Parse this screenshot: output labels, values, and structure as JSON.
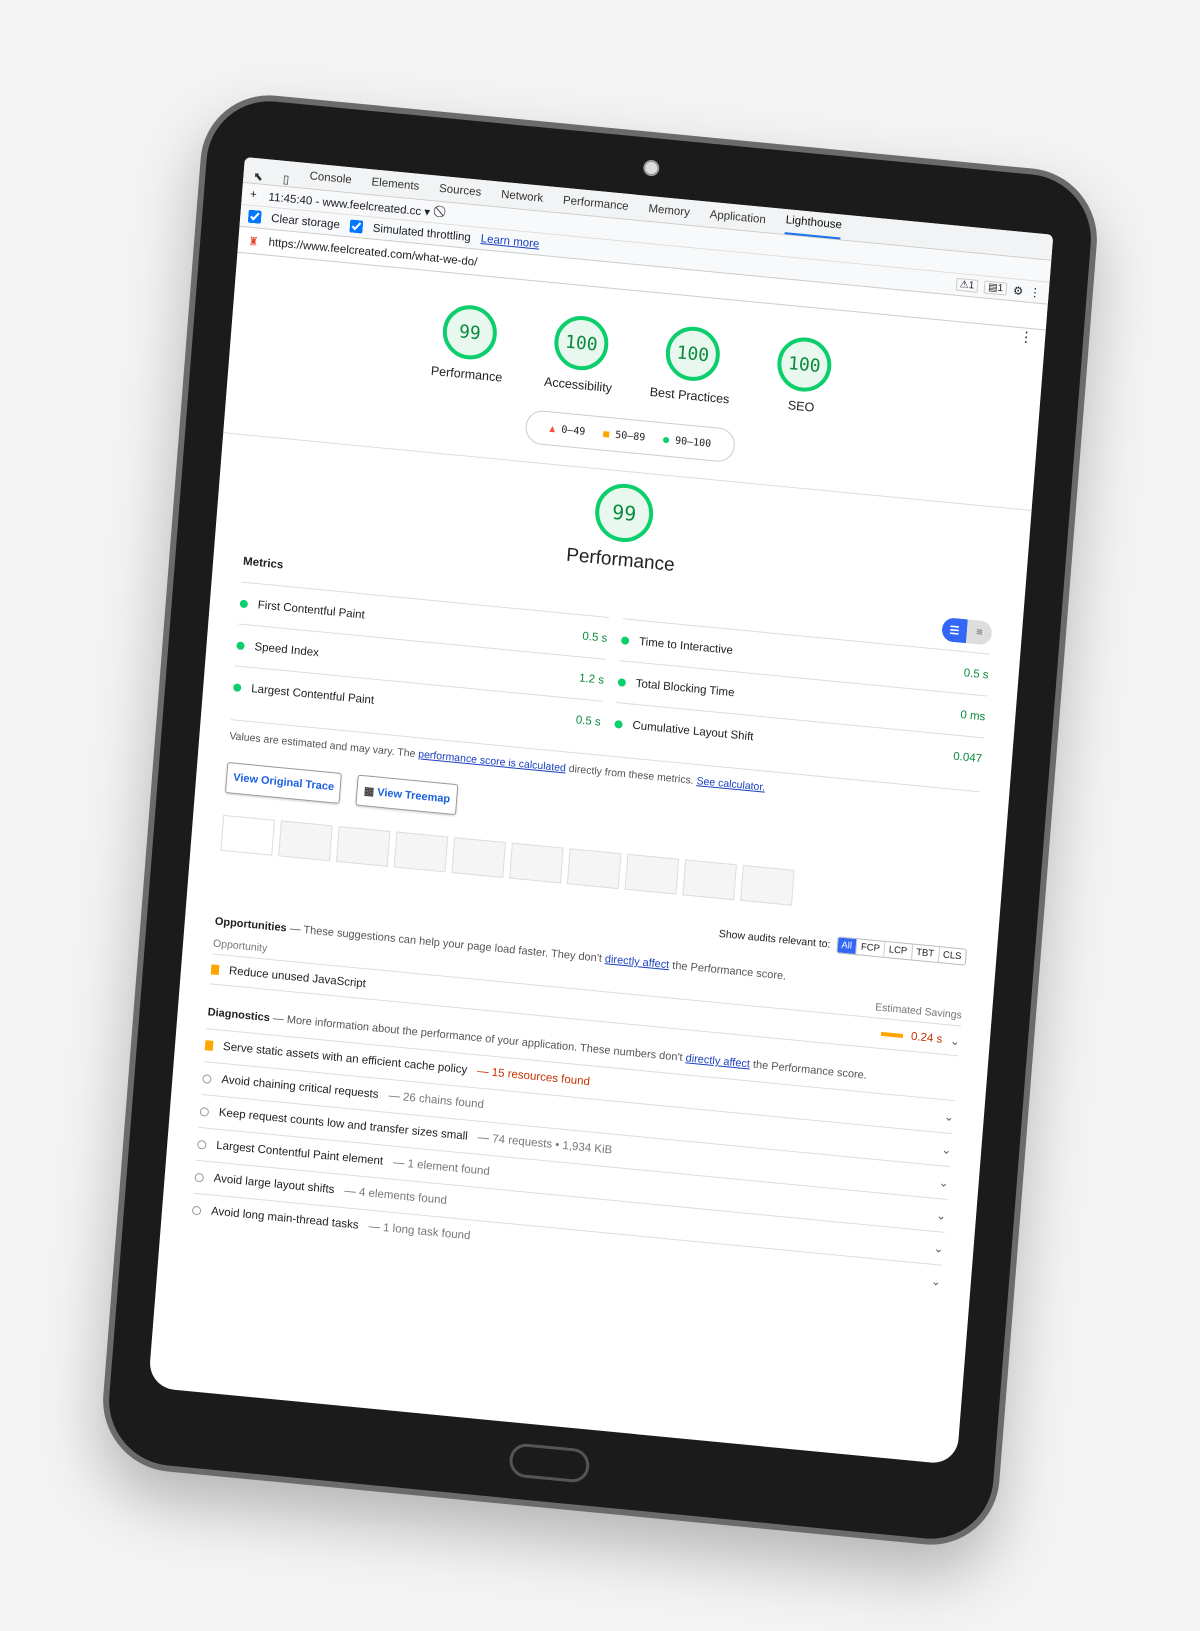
{
  "devtools": {
    "tabs": [
      "Console",
      "Elements",
      "Sources",
      "Network",
      "Performance",
      "Memory",
      "Application",
      "Lighthouse"
    ],
    "active_tab": "Lighthouse",
    "session": "11:45:40 - www.feelcreated.cc ▾",
    "clear_storage": "Clear storage",
    "simulated_throttling": "Simulated throttling",
    "learn_more": "Learn more",
    "warnings": "⚠1",
    "messages": "▤1",
    "url": "https://www.feelcreated.com/what-we-do/"
  },
  "scores": [
    {
      "label": "Performance",
      "score": "99"
    },
    {
      "label": "Accessibility",
      "score": "100"
    },
    {
      "label": "Best Practices",
      "score": "100"
    },
    {
      "label": "SEO",
      "score": "100"
    }
  ],
  "legend": {
    "fail": "0–49",
    "average": "50–89",
    "pass": "90–100"
  },
  "colors": {
    "pass": "#0cce6b",
    "average": "#ffa400",
    "fail": "#ff4e42",
    "accent": "#3367f5"
  },
  "performance": {
    "score": "99",
    "title": "Performance",
    "metrics_label": "Metrics",
    "metrics": [
      {
        "name": "First Contentful Paint",
        "value": "0.5 s"
      },
      {
        "name": "Time to Interactive",
        "value": "0.5 s"
      },
      {
        "name": "Speed Index",
        "value": "1.2 s"
      },
      {
        "name": "Total Blocking Time",
        "value": "0 ms"
      },
      {
        "name": "Largest Contentful Paint",
        "value": "0.5 s"
      },
      {
        "name": "Cumulative Layout Shift",
        "value": "0.047"
      }
    ],
    "note_pre": "Values are estimated and may vary. The ",
    "note_link": "performance score is calculated",
    "note_mid": " directly from these metrics. ",
    "note_link2": "See calculator.",
    "view_trace": "View Original Trace",
    "view_treemap": "View Treemap",
    "filter_label": "Show audits relevant to:",
    "filters": [
      "All",
      "FCP",
      "LCP",
      "TBT",
      "CLS"
    ]
  },
  "opportunities": {
    "title": "Opportunities",
    "desc_pre": "— These suggestions can help your page load faster. They don't ",
    "link": "directly affect",
    "desc_post": " the Performance score.",
    "col_left": "Opportunity",
    "col_right": "Estimated Savings",
    "items": [
      {
        "title": "Reduce unused JavaScript",
        "savings": "0.24 s"
      }
    ]
  },
  "diagnostics": {
    "title": "Diagnostics",
    "desc_pre": "— More information about the performance of your application. These numbers don't ",
    "link": "directly affect",
    "desc_post": " the Performance score.",
    "items": [
      {
        "title": "Serve static assets with an efficient cache policy",
        "detail": "— 15 resources found"
      },
      {
        "title": "Avoid chaining critical requests",
        "detail": "— 26 chains found"
      },
      {
        "title": "Keep request counts low and transfer sizes small",
        "detail": "— 74 requests • 1,934 KiB"
      },
      {
        "title": "Largest Contentful Paint element",
        "detail": "— 1 element found"
      },
      {
        "title": "Avoid large layout shifts",
        "detail": "— 4 elements found"
      },
      {
        "title": "Avoid long main-thread tasks",
        "detail": "— 1 long task found"
      }
    ]
  }
}
